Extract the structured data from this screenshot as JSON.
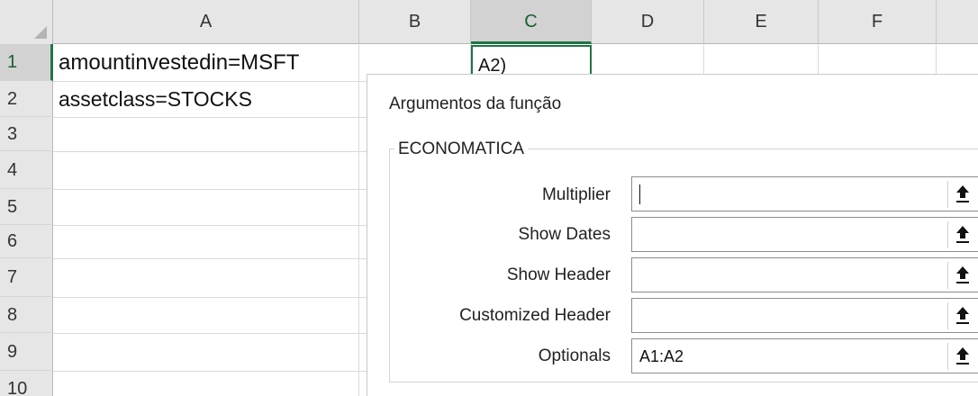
{
  "columns": [
    "A",
    "B",
    "C",
    "D",
    "E",
    "F"
  ],
  "rows": [
    "1",
    "2",
    "3",
    "4",
    "5",
    "6",
    "7",
    "8",
    "9",
    "10"
  ],
  "cells": {
    "A1": "amountinvestedin=MSFT",
    "A2": "assetclass=STOCKS",
    "C1": "A2)"
  },
  "dialog": {
    "title": "Argumentos da função",
    "group_label": "ECONOMATICA",
    "args": [
      {
        "label": "Multiplier",
        "value": ""
      },
      {
        "label": "Show Dates",
        "value": ""
      },
      {
        "label": "Show Header",
        "value": ""
      },
      {
        "label": "Customized Header",
        "value": ""
      },
      {
        "label": "Optionals",
        "value": "A1:A2"
      }
    ]
  },
  "colors": {
    "accent": "#217346",
    "header_bg": "#e6e6e6",
    "selected_header_bg": "#d2d2d2"
  }
}
